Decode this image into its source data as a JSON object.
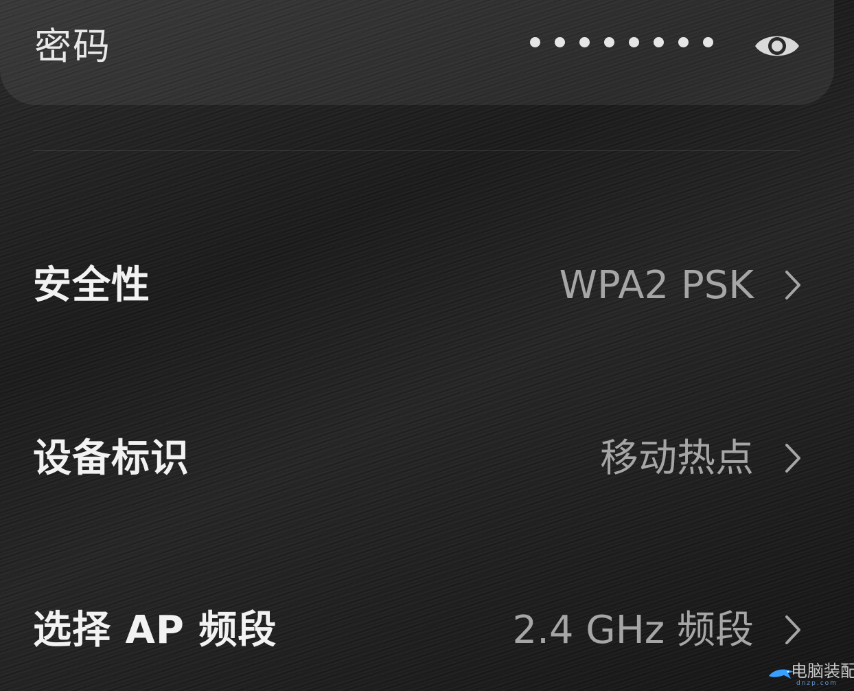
{
  "password": {
    "label": "密码",
    "masked_length": 8,
    "visibility_icon": "eye-icon"
  },
  "rows": [
    {
      "label": "安全性",
      "value": "WPA2 PSK",
      "icon": "chevron-right-icon"
    },
    {
      "label": "设备标识",
      "value": "移动热点",
      "icon": "chevron-right-icon"
    },
    {
      "label": "选择 AP 频段",
      "value": "2.4 GHz 频段",
      "icon": "chevron-right-icon"
    }
  ],
  "watermark": {
    "text": "电脑装配网",
    "sub": "dnzp.com"
  },
  "colors": {
    "background": "#1a1a1a",
    "label_text": "#f2f2f2",
    "value_text": "#a6a6a6",
    "card": "#2b2b2b"
  }
}
